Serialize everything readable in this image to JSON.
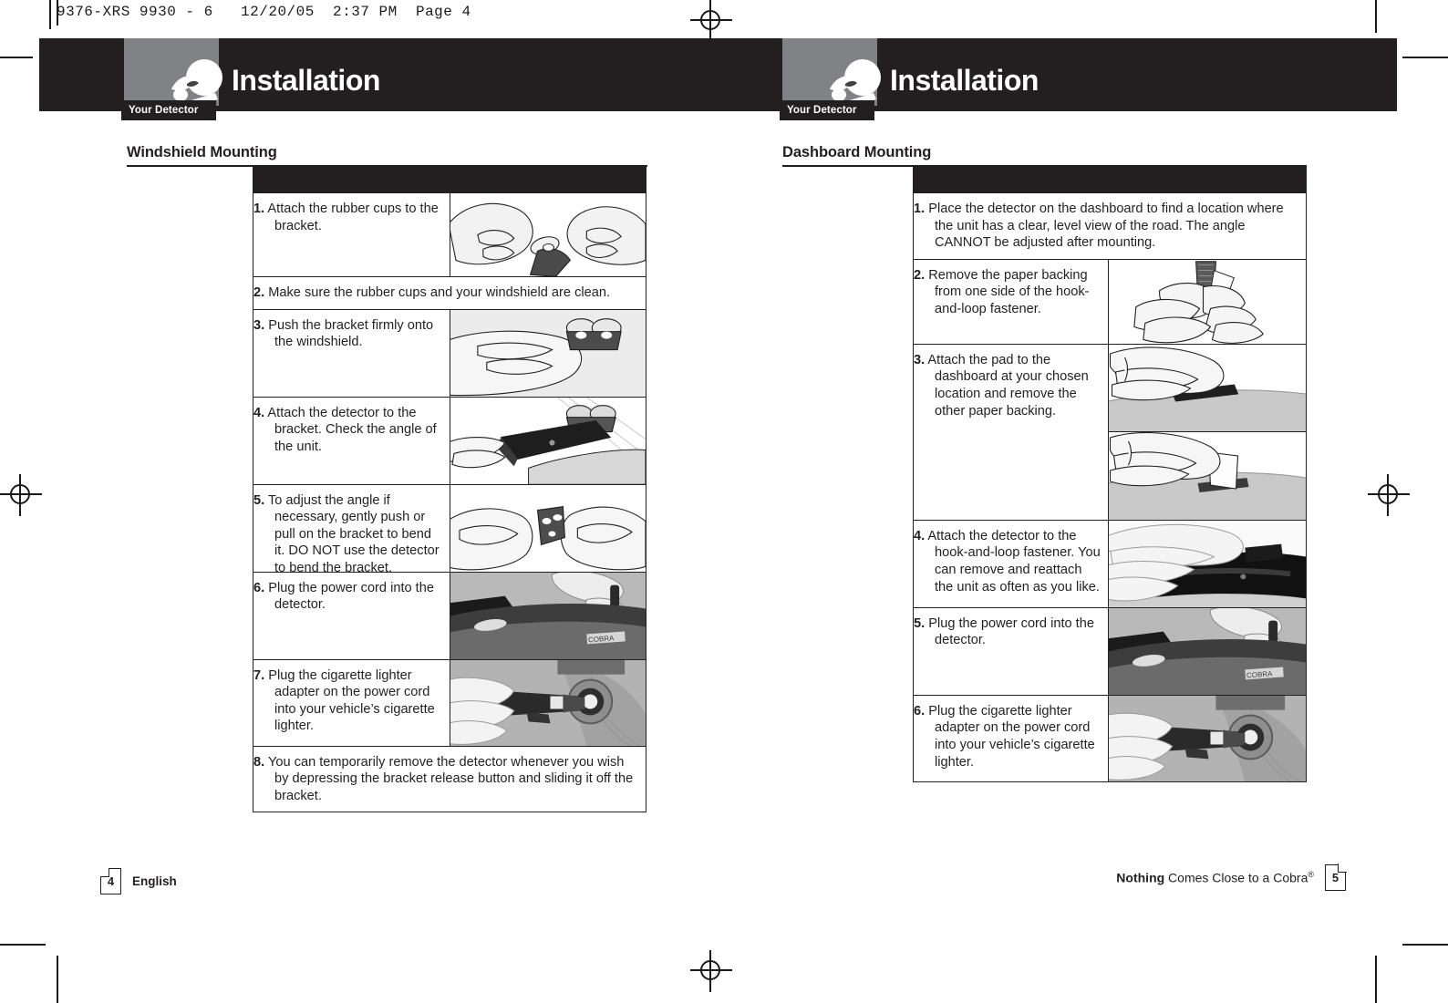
{
  "slug": "9376-XRS 9930 - 6   12/20/05  2:37 PM  Page 4",
  "header": {
    "left_title": "Installation",
    "right_title": "Installation",
    "badge": "Your Detector",
    "logo_icon": "cobra-head-icon"
  },
  "left_page": {
    "section_title": "Windshield Mounting",
    "steps": [
      {
        "num": "1.",
        "text": "Attach the rubber cups to the bracket.",
        "has_image": true,
        "image_name": "attach-rubber-cups-illustration"
      },
      {
        "num": "2.",
        "text": "Make sure the rubber cups and your windshield are clean.",
        "has_image": false
      },
      {
        "num": "3.",
        "text": "Push the bracket firmly onto the windshield.",
        "has_image": true,
        "image_name": "push-bracket-windshield-illustration"
      },
      {
        "num": "4.",
        "text": "Attach the detector to the bracket. Check the angle of the unit.",
        "has_image": true,
        "image_name": "attach-detector-bracket-illustration"
      },
      {
        "num": "5.",
        "text": "To adjust the angle if necessary, gently push or pull on the bracket to bend it. DO NOT use the detector to bend the bracket.",
        "has_image": true,
        "image_name": "bend-bracket-illustration"
      },
      {
        "num": "6.",
        "text": "Plug the power cord into the detector.",
        "has_image": true,
        "image_name": "plug-power-cord-detector-photo"
      },
      {
        "num": "7.",
        "text": "Plug the cigarette lighter adapter on the power cord into your vehicle’s cigarette lighter.",
        "has_image": true,
        "image_name": "cigarette-lighter-adapter-photo"
      },
      {
        "num": "8.",
        "text": "You can temporarily remove the detector whenever you wish by depressing the bracket release button and sliding it off the bracket.",
        "has_image": false
      }
    ],
    "footer": {
      "page_number": "4",
      "language": "English"
    }
  },
  "right_page": {
    "section_title": "Dashboard Mounting",
    "steps": [
      {
        "num": "1.",
        "text": "Place the detector on the dashboard to find a location where the unit has a clear, level view of the road. The angle CANNOT be adjusted after mounting.",
        "has_image": false
      },
      {
        "num": "2.",
        "text": "Remove the paper backing from one side of the hook-and-loop fastener.",
        "has_image": true,
        "image_name": "remove-paper-backing-illustration"
      },
      {
        "num": "3.",
        "text": "Attach the pad to the dashboard at your chosen location and remove the other paper backing.",
        "has_image": true,
        "image_name": "attach-pad-dashboard-illustration"
      },
      {
        "num": "4.",
        "text": "Attach the detector to the hook-and-loop fastener. You can remove and reattach the unit as often as you like.",
        "has_image": true,
        "image_name": "attach-detector-fastener-photo"
      },
      {
        "num": "5.",
        "text": "Plug the power cord into the detector.",
        "has_image": true,
        "image_name": "plug-power-cord-detector-photo"
      },
      {
        "num": "6.",
        "text": "Plug the cigarette lighter adapter on the power cord into your vehicle’s cigarette lighter.",
        "has_image": true,
        "image_name": "cigarette-lighter-adapter-photo"
      }
    ],
    "footer": {
      "page_number": "5",
      "tagline_bold": "Nothing",
      "tagline_rest": " Comes Close to a Cobra",
      "tagline_mark": "®"
    }
  },
  "colors": {
    "ink": "#231f20",
    "gray_box": "#808285",
    "paper": "#ffffff"
  }
}
